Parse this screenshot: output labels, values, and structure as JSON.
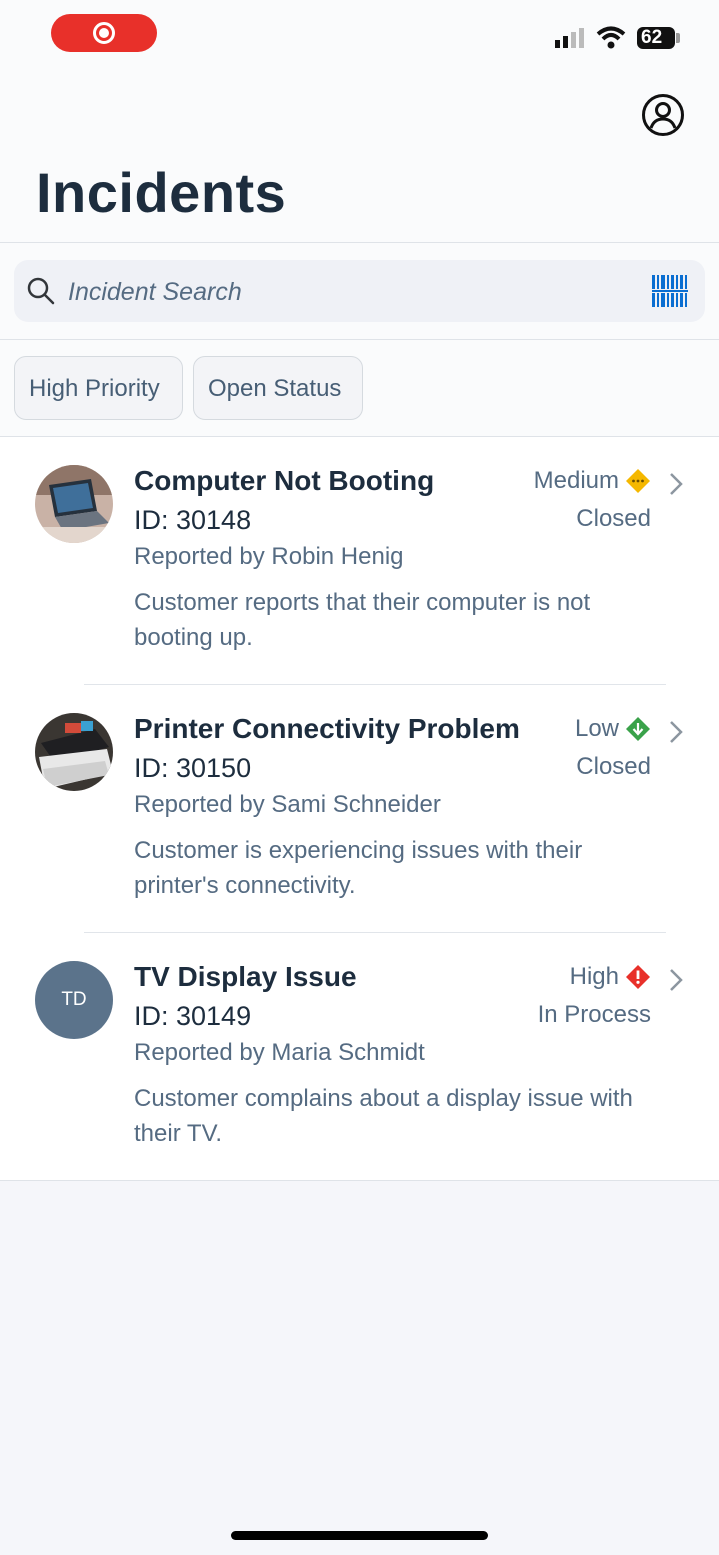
{
  "status_bar": {
    "battery": "62"
  },
  "header": {
    "title": "Incidents",
    "profile_icon": "user-circle-icon"
  },
  "search": {
    "placeholder": "Incident Search",
    "value": ""
  },
  "filters": [
    "High Priority",
    "Open Status"
  ],
  "incidents": [
    {
      "title": "Computer Not Booting",
      "id": "ID: 30148",
      "reporter": "Reported by Robin Henig",
      "description": "Customer reports that their computer is not booting up.",
      "priority": "Medium",
      "status": "Closed",
      "priority_color": "#f5b800",
      "avatar": "laptop-photo"
    },
    {
      "title": "Printer Connectivity Problem",
      "id": "ID: 30150",
      "reporter": "Reported by Sami Schneider",
      "description": "Customer is experiencing issues with their printer's connectivity.",
      "priority": "Low",
      "status": "Closed",
      "priority_color": "#3aa24a",
      "avatar": "printer-photo"
    },
    {
      "title": "TV Display Issue",
      "id": "ID: 30149",
      "reporter": "Reported by Maria Schmidt",
      "description": "Customer complains about a display issue with their TV.",
      "priority": "High",
      "status": "In Process",
      "priority_color": "#e8302a",
      "avatar_initials": "TD"
    }
  ],
  "colors": {
    "accent": "#0a6ed1",
    "title": "#1d2d3e",
    "secondary_text": "#556b82"
  }
}
